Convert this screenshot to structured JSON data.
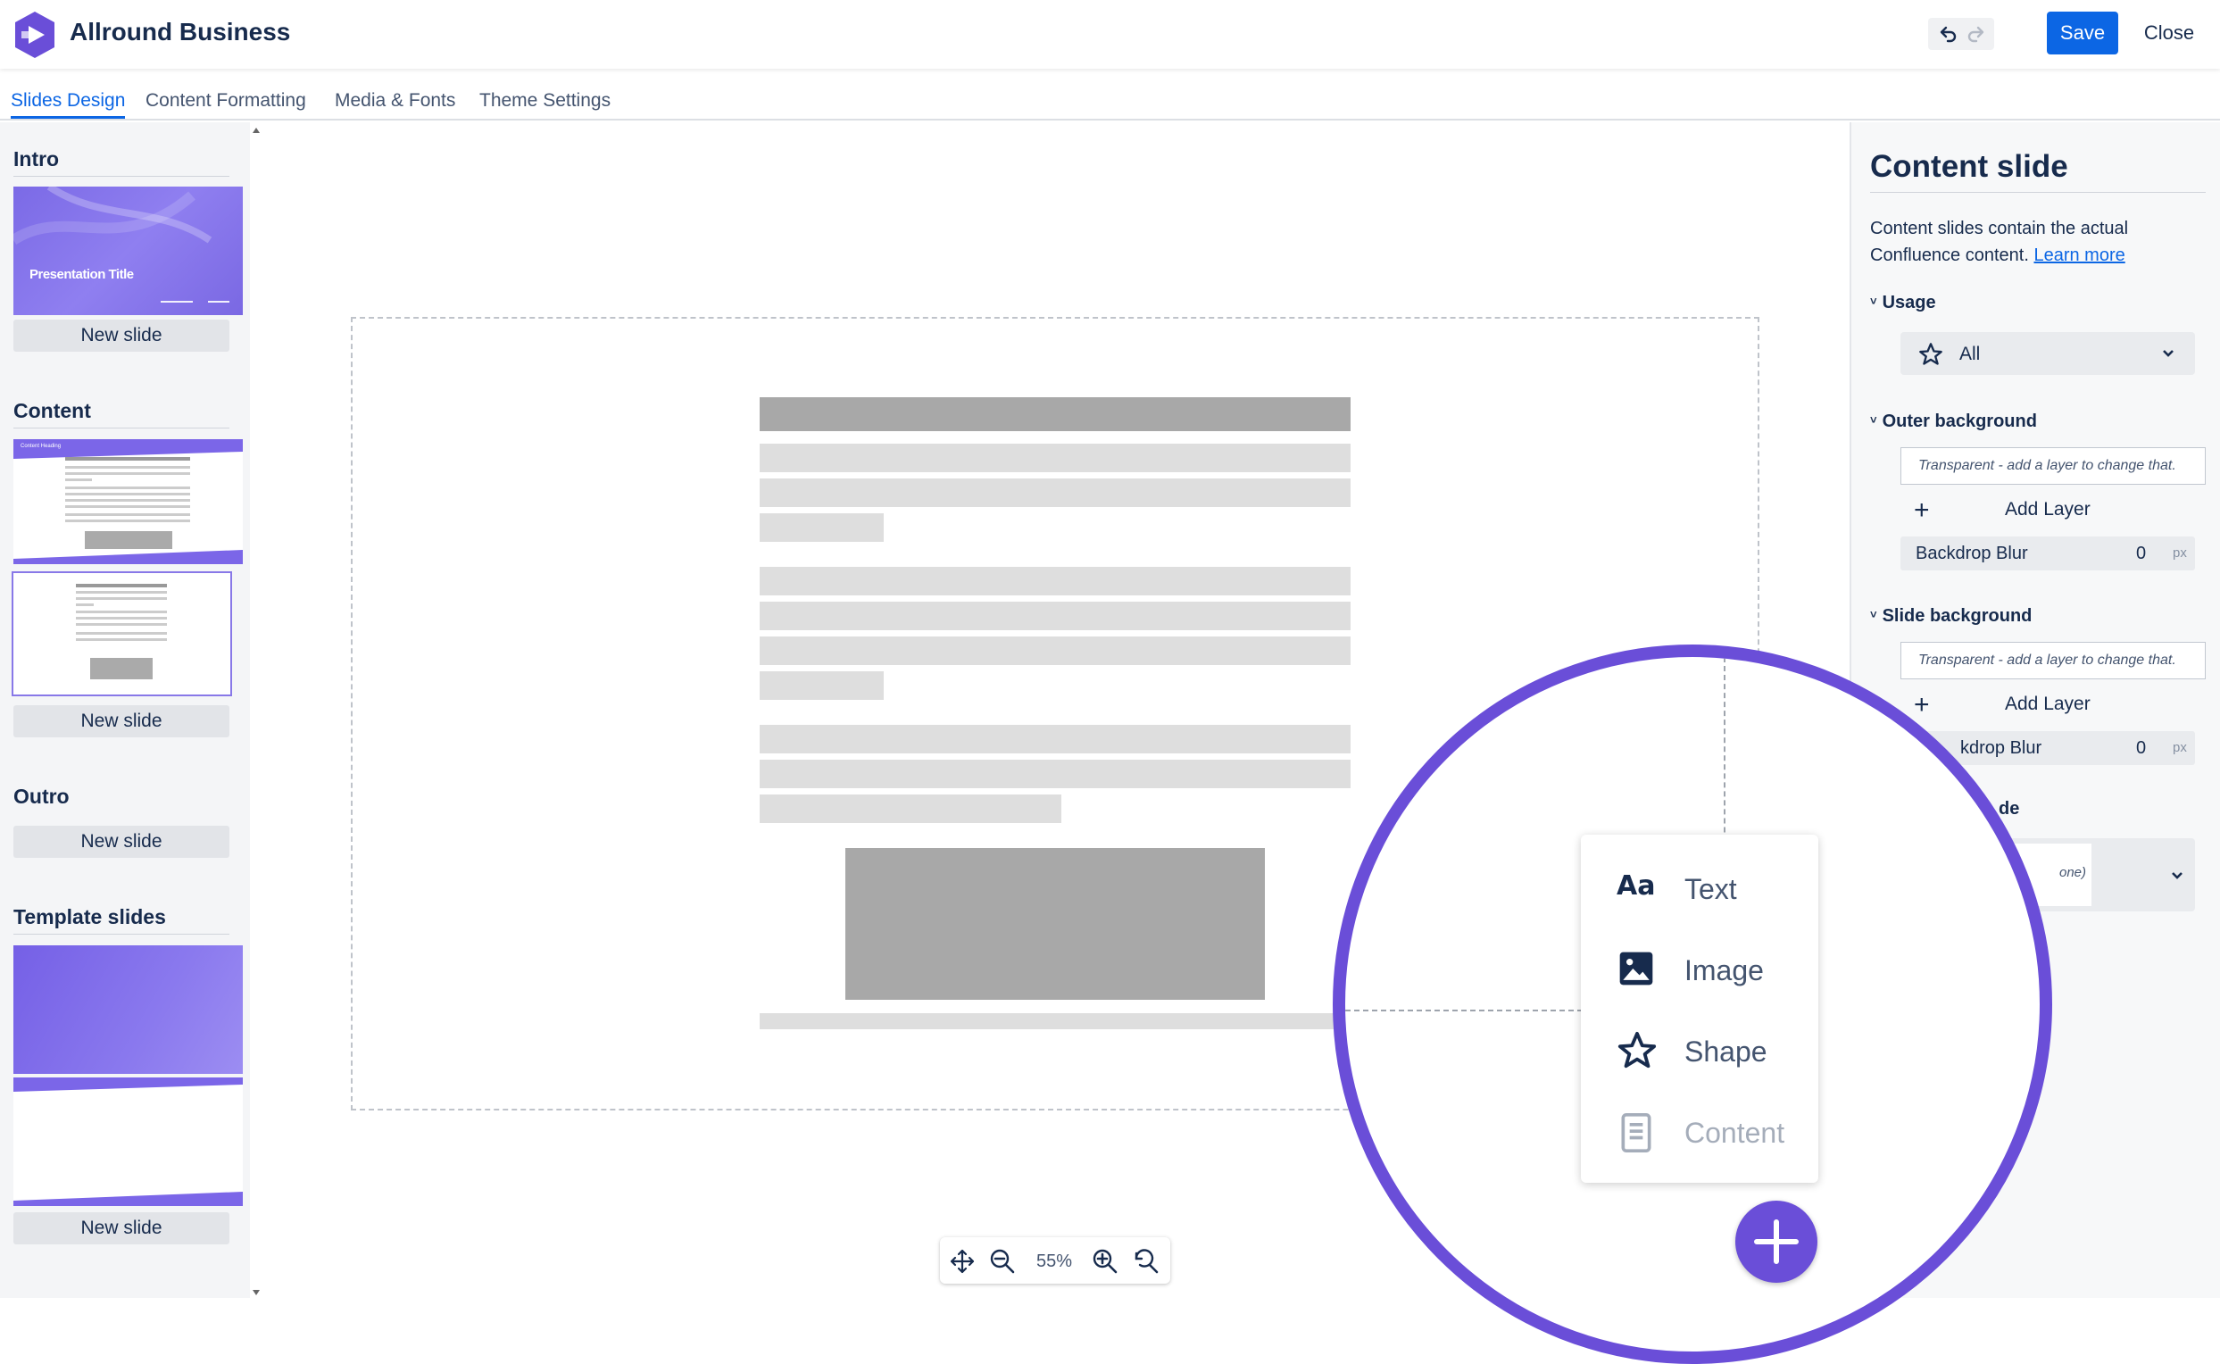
{
  "header": {
    "app_title": "Allround Business",
    "save_label": "Save",
    "close_label": "Close"
  },
  "tabs": [
    {
      "label": "Slides Design",
      "active": true
    },
    {
      "label": "Content Formatting",
      "active": false
    },
    {
      "label": "Media & Fonts",
      "active": false
    },
    {
      "label": "Theme Settings",
      "active": false
    }
  ],
  "sidebar": {
    "sections": [
      {
        "title": "Intro",
        "thumb_text": "Presentation Title",
        "new_slide_label": "New slide"
      },
      {
        "title": "Content",
        "thumb_text": "Content Heading",
        "new_slide_label": "New slide"
      },
      {
        "title": "Outro",
        "new_slide_label": "New slide"
      },
      {
        "title": "Template slides",
        "new_slide_label": "New slide"
      }
    ]
  },
  "zoom": {
    "level": "55%"
  },
  "right_panel": {
    "title": "Content slide",
    "description": "Content slides contain the actual Confluence content.",
    "learn_more": "Learn more",
    "usage": {
      "title": "Usage",
      "value": "All"
    },
    "outer_background": {
      "title": "Outer background",
      "note": "Transparent - add a layer to change that.",
      "add_layer": "Add Layer",
      "blur_label": "Backdrop Blur",
      "blur_value": "0",
      "blur_unit": "px"
    },
    "slide_background": {
      "title": "Slide background",
      "note": "Transparent - add a layer to change that.",
      "add_layer": "Add Layer",
      "blur_label": "kdrop Blur",
      "blur_value": "0",
      "blur_unit": "px"
    },
    "partial": {
      "section_fragment": "de",
      "select_fragment": "one)"
    }
  },
  "insert_menu": {
    "items": [
      {
        "label": "Text",
        "icon": "text-aa-icon",
        "disabled": false
      },
      {
        "label": "Image",
        "icon": "image-icon",
        "disabled": false
      },
      {
        "label": "Shape",
        "icon": "star-icon",
        "disabled": false
      },
      {
        "label": "Content",
        "icon": "document-icon",
        "disabled": true
      }
    ]
  },
  "colors": {
    "accent": "#6a4ed8",
    "primary_button": "#0c66e4",
    "active_tab": "#0c66e4"
  }
}
